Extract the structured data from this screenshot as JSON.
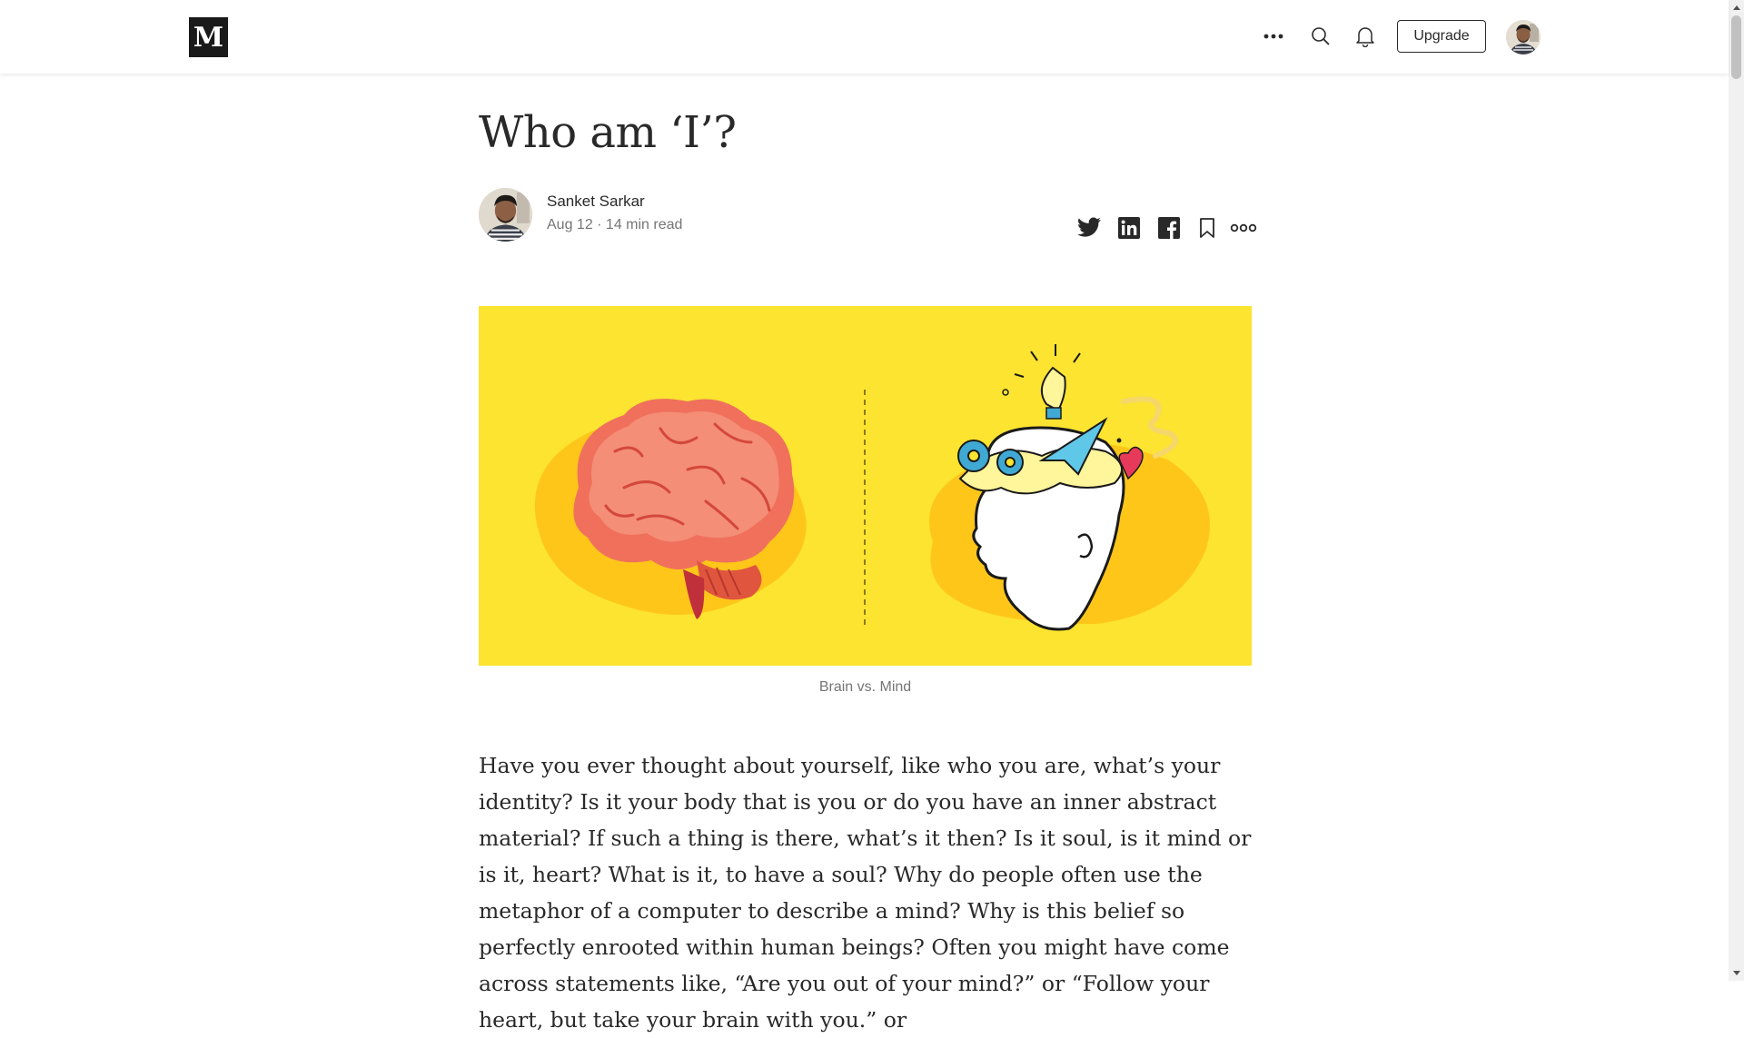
{
  "header": {
    "logo_text": "M",
    "upgrade_label": "Upgrade"
  },
  "article": {
    "title": "Who am ‘I’?",
    "author": {
      "name": "Sanket Sarkar",
      "meta": "Aug 12 · 14 min read"
    },
    "image_caption": "Brain vs. Mind",
    "body": "Have you ever thought about yourself, like who you are, what’s your identity? Is it your body that is you or do you have an inner abstract material? If such a thing is there, what’s it then? Is it soul, is it mind or is it, heart? What is it, to have a soul? Why do people often use the metaphor of a computer to describe a mind? Why is this belief so perfectly enrooted within human beings? Often you might have come across statements like, “Are you out of your mind?” or “Follow your heart, but take your brain with you.” or"
  },
  "icons": [
    "more-options-icon",
    "search-icon",
    "bell-icon",
    "twitter-icon",
    "linkedin-icon",
    "facebook-icon",
    "bookmark-icon",
    "more-icon"
  ],
  "colors": {
    "hero_background": "#fce430",
    "brain": "#f07862",
    "accent_text": "#292929",
    "muted_text": "#757575"
  }
}
